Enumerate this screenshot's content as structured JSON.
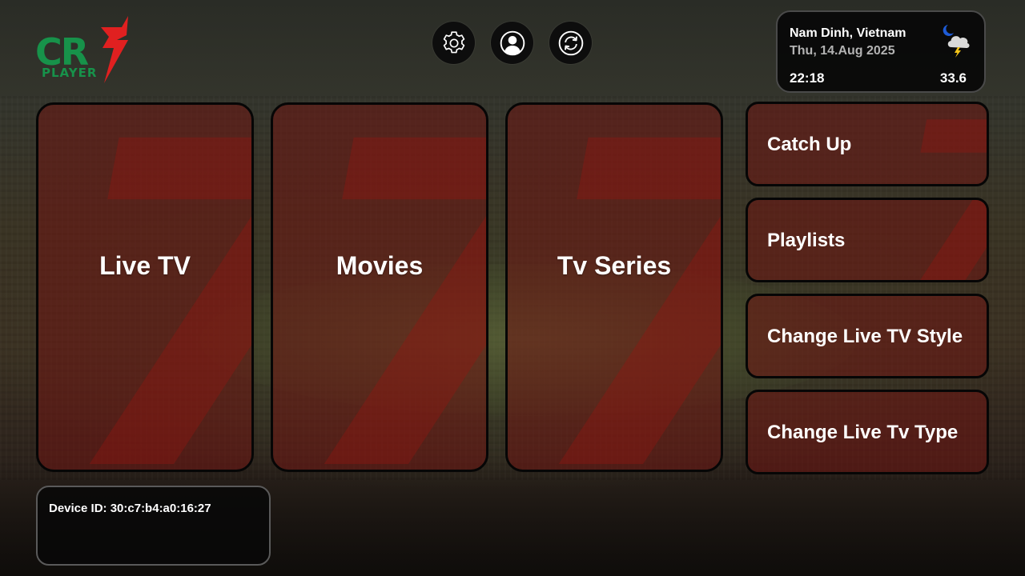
{
  "app": {
    "logo_letters": "CR",
    "logo_subtitle": "PLAYER",
    "brand_green": "#17924a",
    "brand_red": "#e02020"
  },
  "top_icons": [
    {
      "icon": "gear-icon",
      "label": "Settings"
    },
    {
      "icon": "user-icon",
      "label": "Account"
    },
    {
      "icon": "refresh-icon",
      "label": "Refresh"
    }
  ],
  "weather": {
    "location": "Nam Dinh, Vietnam",
    "date": "Thu, 14.Aug 2025",
    "time": "22:18",
    "temperature": "33.6",
    "icon": "night-thunderstorm-icon"
  },
  "main_tiles": [
    {
      "label": "Live TV"
    },
    {
      "label": "Movies"
    },
    {
      "label": "Tv Series"
    }
  ],
  "side_menu": [
    {
      "label": "Catch Up"
    },
    {
      "label": "Playlists"
    },
    {
      "label": "Change Live TV Style"
    },
    {
      "label": "Change Live Tv Type"
    }
  ],
  "device": {
    "id_text": "Device ID: 30:c7:b4:a0:16:27"
  },
  "colors": {
    "tile_fill": "#701612",
    "panel_dark": "#080808"
  }
}
